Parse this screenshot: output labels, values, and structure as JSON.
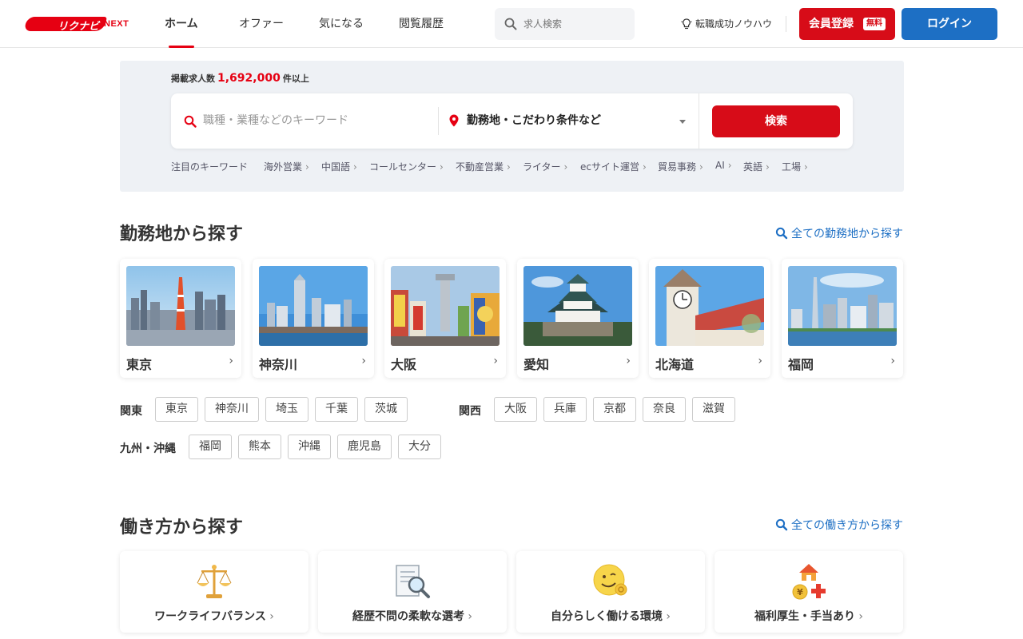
{
  "header": {
    "logo_main": "リクナビ",
    "logo_sub": "NEXT",
    "tabs": [
      {
        "label": "ホーム",
        "active": true
      },
      {
        "label": "オファー"
      },
      {
        "label": "気になる"
      },
      {
        "label": "閲覧履歴"
      }
    ],
    "search_placeholder": "求人検索",
    "tips_label": "転職成功ノウハウ",
    "register_label": "会員登録",
    "register_badge": "無料",
    "login_label": "ログイン"
  },
  "search_panel": {
    "count_prefix": "掲載求人数",
    "count_value": "1,692,000",
    "count_suffix": "件以上",
    "keyword_placeholder": "職種・業種などのキーワード",
    "location_label": "勤務地・こだわり条件など",
    "search_button": "検索",
    "trending_label": "注目のキーワード",
    "trending": [
      "海外営業",
      "中国語",
      "コールセンター",
      "不動産営業",
      "ライター",
      "ecサイト運営",
      "貿易事務",
      "AI",
      "英語",
      "工場"
    ]
  },
  "location_section": {
    "title": "勤務地から探す",
    "all_link": "全ての勤務地から探す",
    "cards": [
      {
        "name": "東京",
        "photo": "tokyo-tower-skyline"
      },
      {
        "name": "神奈川",
        "photo": "yokohama-bay-skyline"
      },
      {
        "name": "大阪",
        "photo": "tsutenkaku-street"
      },
      {
        "name": "愛知",
        "photo": "nagoya-castle"
      },
      {
        "name": "北海道",
        "photo": "sapporo-clock-tower"
      },
      {
        "name": "福岡",
        "photo": "fukuoka-tower-skyline"
      }
    ],
    "regions": [
      {
        "label": "関東",
        "prefs": [
          "東京",
          "神奈川",
          "埼玉",
          "千葉",
          "茨城"
        ]
      },
      {
        "label": "関西",
        "prefs": [
          "大阪",
          "兵庫",
          "京都",
          "奈良",
          "滋賀"
        ]
      },
      {
        "label": "九州・沖縄",
        "prefs": [
          "福岡",
          "熊本",
          "沖縄",
          "鹿児島",
          "大分"
        ]
      }
    ]
  },
  "workstyle_section": {
    "title": "働き方から探す",
    "all_link": "全ての働き方から探す",
    "cards": [
      {
        "label": "ワークライフバランス",
        "icon": "balance-scale-icon"
      },
      {
        "label": "経歴不問の柔軟な選考",
        "icon": "document-magnifier-icon"
      },
      {
        "label": "自分らしく働ける環境",
        "icon": "smiley-ok-icon"
      },
      {
        "label": "福利厚生・手当あり",
        "icon": "house-yen-cross-icon"
      }
    ]
  },
  "colors": {
    "brand_red": "#e60012",
    "button_red": "#d70c18",
    "login_blue": "#1d6fc4",
    "panel_bg": "#eef1f5"
  }
}
